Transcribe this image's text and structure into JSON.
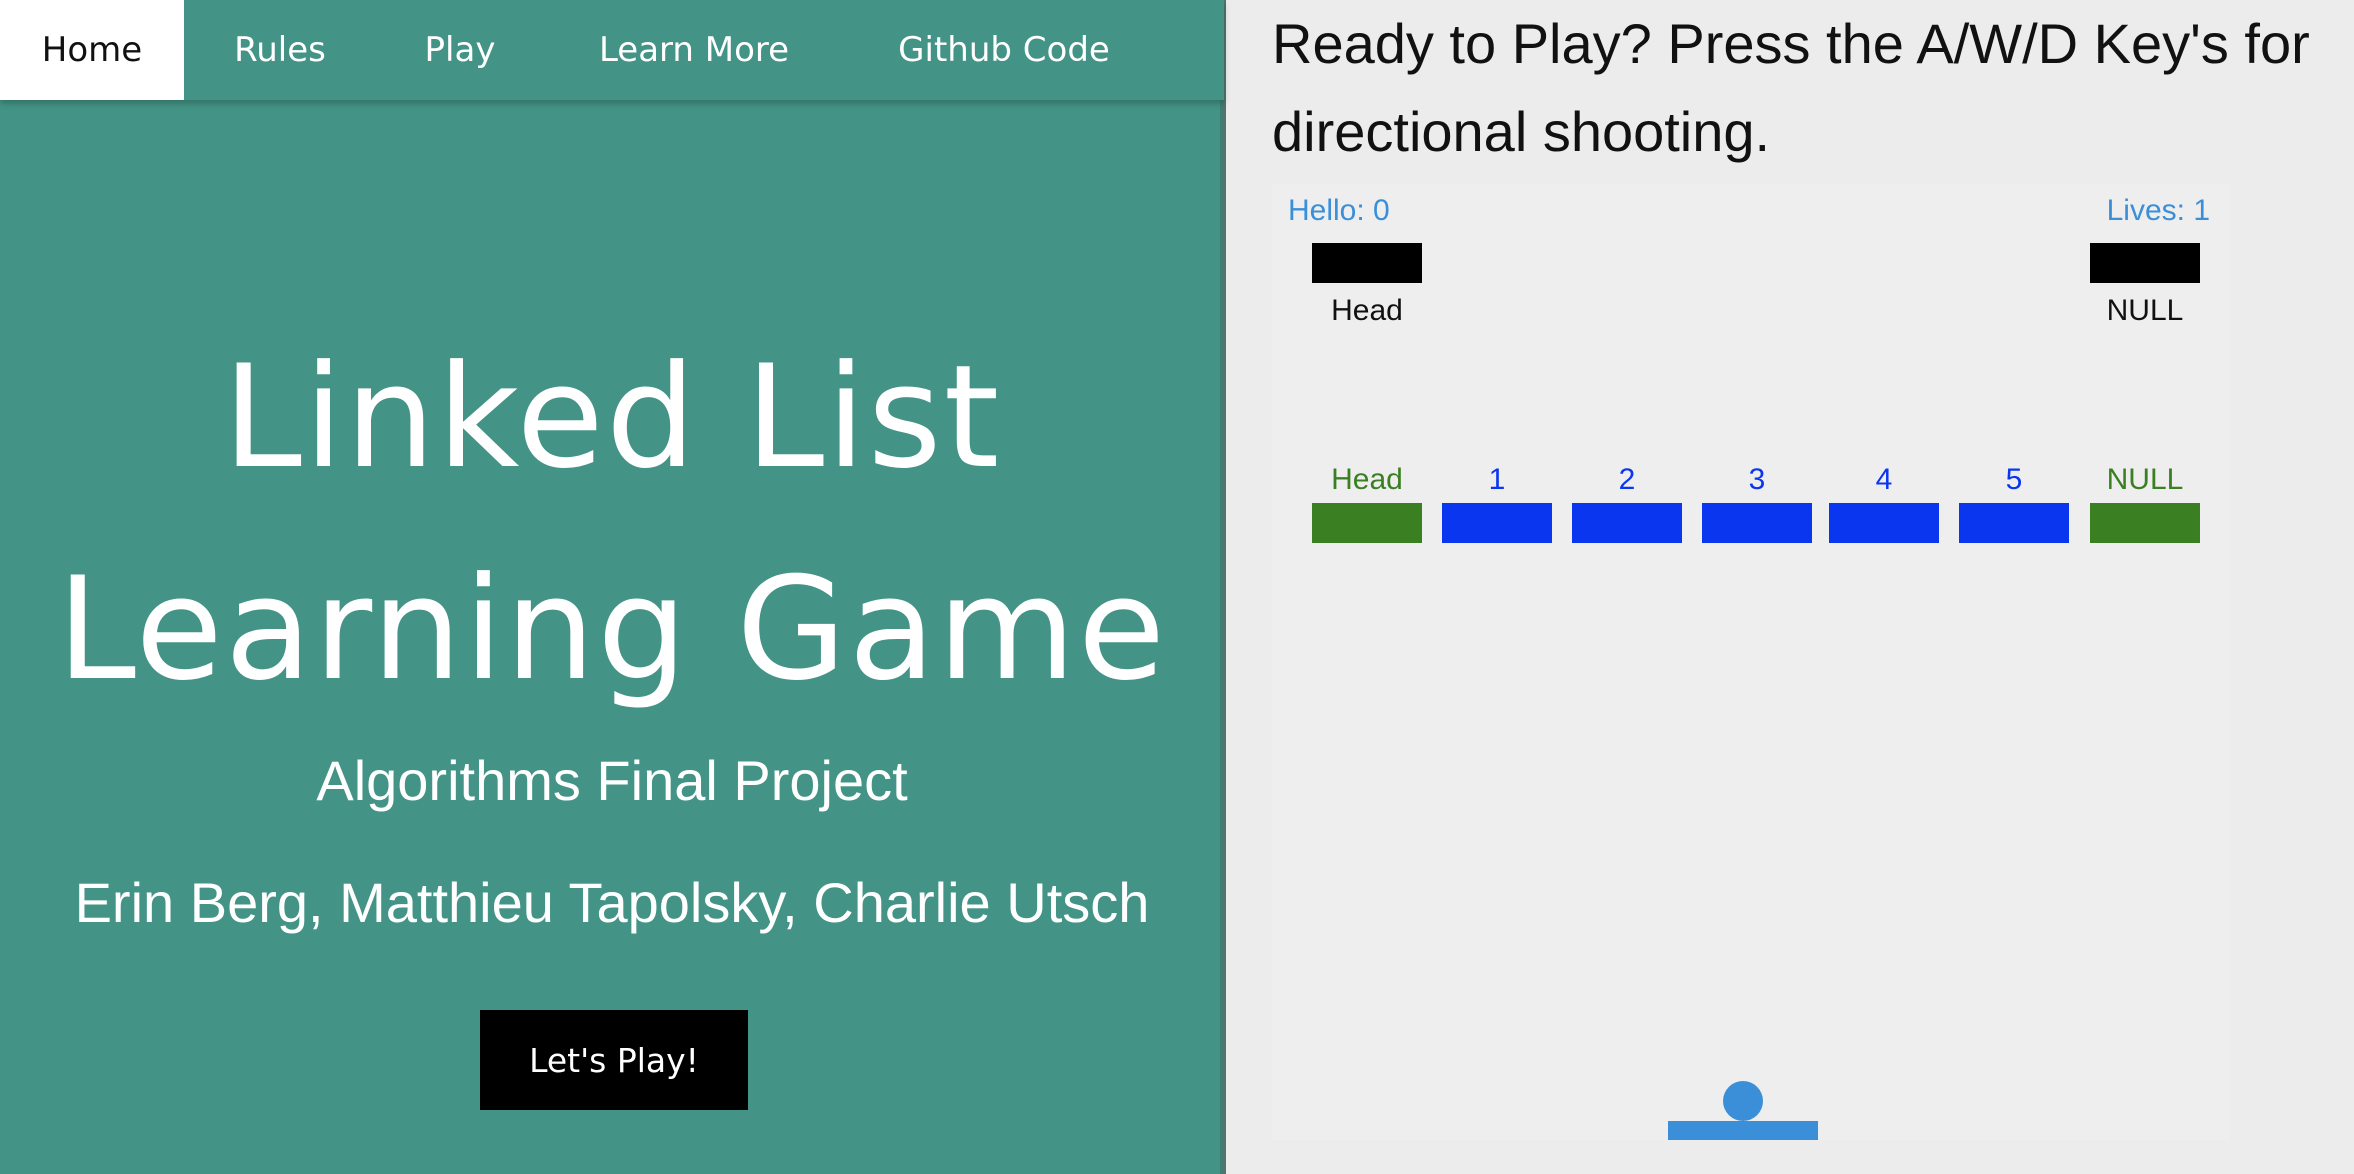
{
  "nav": {
    "items": [
      {
        "label": "Home",
        "active": true
      },
      {
        "label": "Rules",
        "active": false
      },
      {
        "label": "Play",
        "active": false
      },
      {
        "label": "Learn More",
        "active": false
      },
      {
        "label": "Github Code",
        "active": false
      }
    ]
  },
  "hero": {
    "title_line1": "Linked List",
    "title_line2": "Learning Game",
    "subtitle": "Algorithms Final Project",
    "authors": "Erin Berg, Matthieu Tapolsky, Charlie Utsch",
    "play_button": "Let's Play!"
  },
  "game": {
    "instructions": "Ready to Play? Press the A/W/D Key's for directional shooting.",
    "score_text": "Hello: 0",
    "lives_text": "Lives: 1",
    "player_list": {
      "head_label": "Head",
      "null_label": "NULL"
    },
    "target_list": {
      "labels": [
        "Head",
        "1",
        "2",
        "3",
        "4",
        "5",
        "NULL"
      ]
    },
    "colors": {
      "background": "#ececec",
      "hud": "#3b8fd8",
      "head_null_block": "#3b7f23",
      "node_block": "#0a36f0",
      "player_block": "#000000",
      "paddle": "#3b8fd8",
      "ball": "#3b8fd8"
    }
  },
  "colors": {
    "brand_teal": "#439486",
    "button": "#000000"
  }
}
